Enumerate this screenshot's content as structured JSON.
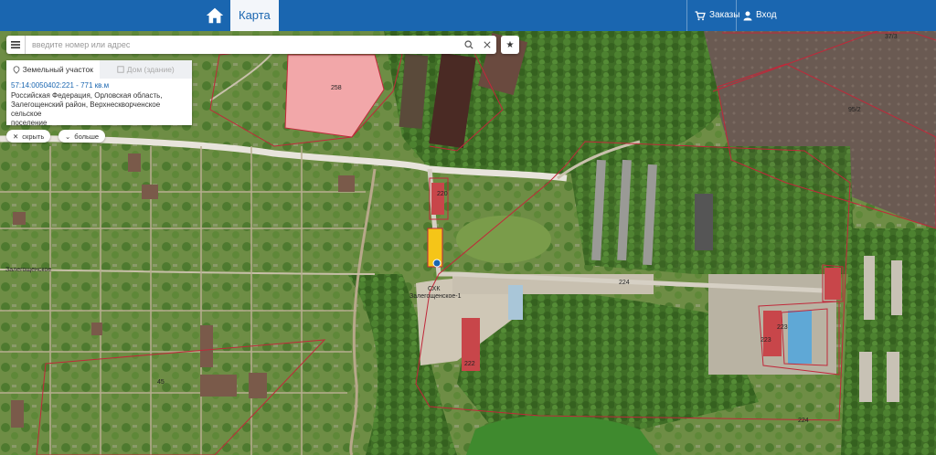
{
  "header": {
    "tab_label": "Карта",
    "orders_label": "Заказы",
    "login_label": "Вход"
  },
  "search": {
    "placeholder": "введите номер или адрес",
    "value": ""
  },
  "panel": {
    "tab_land": "Земельный участок",
    "tab_house": "Дом (здание)",
    "cadastral": "57:14:0050402:221 - 771 кв.м",
    "address_line1": "Российская Федерация, Орловская область,",
    "address_line2": "Залегощенский район, Верхнескворченское сельское",
    "address_line3": "поселение",
    "hide_label": "скрыть",
    "more_label": "больше"
  },
  "map_labels": {
    "parcel_258": "258",
    "parcel_95_2": "95/2",
    "parcel_37_3": "37/3",
    "parcel_224a": "224",
    "parcel_224b": "224",
    "parcel_223a": "223",
    "parcel_222": "222",
    "parcel_223b": "223",
    "parcel_45": "45",
    "parcel_220": "220",
    "road_label": "Залегощенское",
    "site_label_1": "СХК",
    "site_label_2": "Залегощенское-1"
  },
  "colors": {
    "header": "#1a66b0",
    "parcel_outline": "#c0283a",
    "selected_parcel": "#f5c518",
    "highlight_parcel": "#f2a7a9"
  }
}
